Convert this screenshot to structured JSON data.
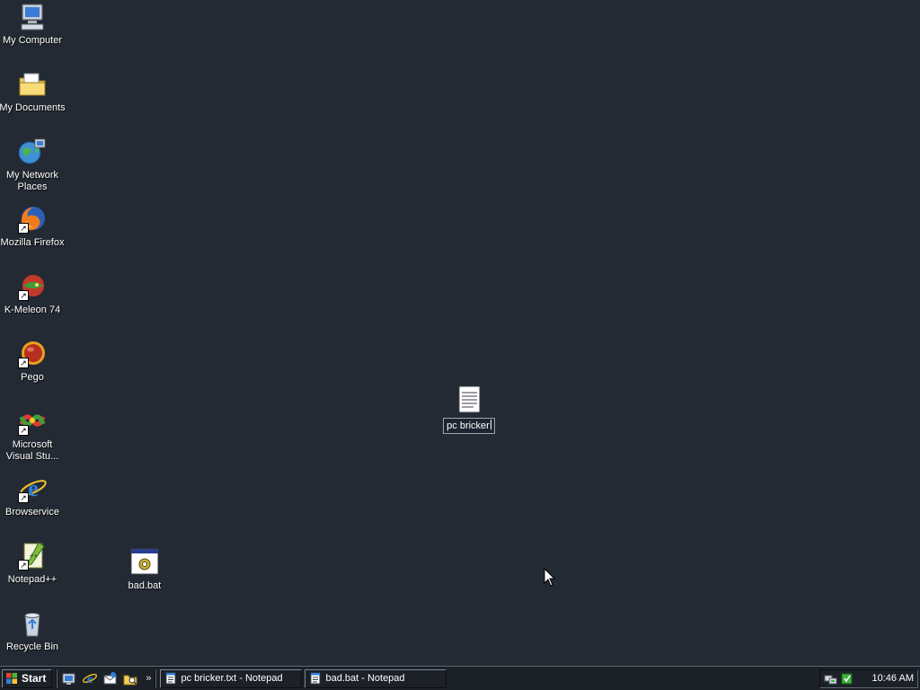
{
  "desktop": {
    "icons": [
      {
        "label": "My Computer"
      },
      {
        "label": "My Documents"
      },
      {
        "label": "My Network\nPlaces"
      },
      {
        "label": "Mozilla Firefox"
      },
      {
        "label": "K-Meleon 74"
      },
      {
        "label": "Pego"
      },
      {
        "label": "Microsoft\nVisual Stu..."
      },
      {
        "label": "Browservice"
      },
      {
        "label": "Notepad++"
      },
      {
        "label": "Recycle Bin"
      }
    ],
    "bad_bat": {
      "label": "bad.bat"
    },
    "renaming_file": {
      "value": "pc bricker"
    }
  },
  "taskbar": {
    "start_label": "Start",
    "quick_launch_more": "»",
    "tasks": [
      {
        "label": "pc bricker.txt - Notepad"
      },
      {
        "label": "bad.bat - Notepad"
      }
    ],
    "clock": "10:46 AM"
  }
}
